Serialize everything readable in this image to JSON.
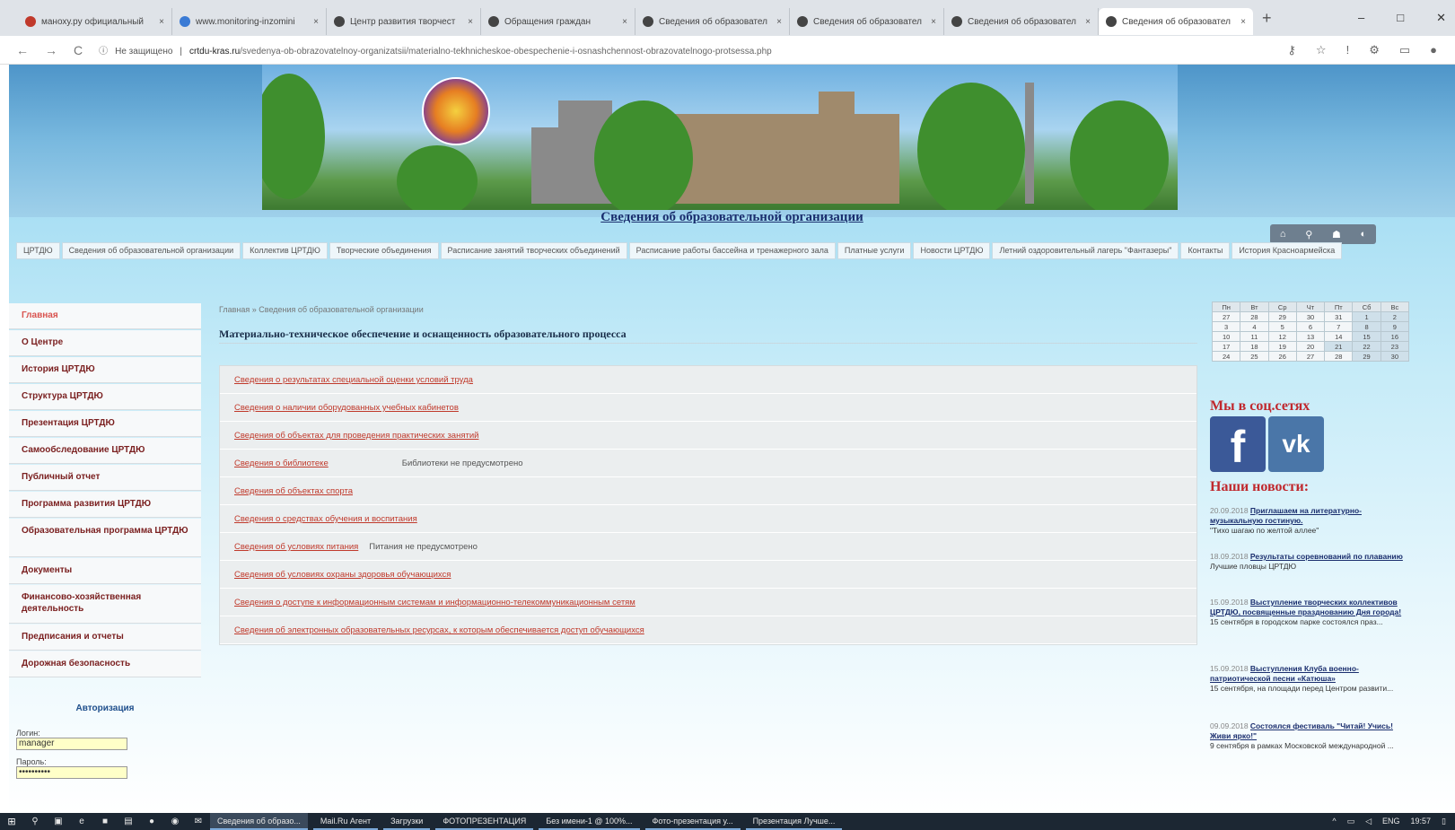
{
  "browser": {
    "tabs": [
      {
        "title": "маноху.ру официальный"
      },
      {
        "title": "www.monitoring-inzomini"
      },
      {
        "title": "Центр развития творчест"
      },
      {
        "title": "Обращения граждан"
      },
      {
        "title": "Сведения об образовател"
      },
      {
        "title": "Сведения об образовател"
      },
      {
        "title": "Сведения об образовател"
      },
      {
        "title": "Сведения об образовател"
      }
    ],
    "new_tab": "+",
    "minimize": "–",
    "maximize": "□",
    "close": "✕",
    "back": "←",
    "forward": "→",
    "reload": "C",
    "security_label": "Не защищено",
    "url_host": "crtdu-kras.ru",
    "url_path": "/svedenya-ob-obrazovatelnoy-organizatsii/materialno-tekhnicheskoe-obespechenie-i-osnashchennost-obrazovatelnogo-protsessa.php"
  },
  "site": {
    "title": "Сведения об образовательной организации",
    "top_menu": [
      "ЦРТДЮ",
      "Сведения об образовательной организации",
      "Коллектив ЦРТДЮ",
      "Творческие объединения",
      "Расписание занятий творческих объединений",
      "Расписание работы бассейна и тренажерного зала",
      "Платные услуги",
      "Новости ЦРТДЮ",
      "Летний оздоровительный лагерь \"Фантазеры\"",
      "Контакты",
      "История Красноармейска"
    ],
    "sidebar": [
      "Главная",
      "О Центре",
      "История ЦРТДЮ",
      "Структура ЦРТДЮ",
      "Презентация ЦРТДЮ",
      "Самообследование ЦРТДЮ",
      "Публичный отчет",
      "Программа развития ЦРТДЮ",
      "Образовательная программа ЦРТДЮ",
      "Документы",
      "Финансово-хозяйственная деятельность",
      "Предписания и отчеты",
      "Дорожная безопасность"
    ],
    "auth": {
      "title": "Авторизация",
      "login_label": "Логин:",
      "login_value": "manager",
      "password_label": "Пароль:",
      "password_value": "••••••••••"
    },
    "breadcrumb": "Главная » Сведения об образовательной организации",
    "heading": "Материально-техническое обеспечение и оснащенность образовательного процесса",
    "links": [
      {
        "text": "Сведения о результатах специальной оценки условий труда",
        "note": ""
      },
      {
        "text": "Сведения о наличии оборудованных учебных кабинетов",
        "note": ""
      },
      {
        "text": "Сведения об объектах для проведения практических занятий",
        "note": ""
      },
      {
        "text": "Сведения о библиотеке",
        "note": "Библиотеки не предусмотрено"
      },
      {
        "text": "Сведения об объектах спорта",
        "note": ""
      },
      {
        "text": "Сведения о средствах обучения и воспитания",
        "note": ""
      },
      {
        "text": "Сведения об условиях питания",
        "note": "Питания не предусмотрено"
      },
      {
        "text": "Сведения об условиях охраны здоровья обучающихся",
        "note": ""
      },
      {
        "text": "Сведения о доступе к информационным системам и информационно-телекоммуникационным сетям",
        "note": ""
      },
      {
        "text": "Сведения об электронных образовательных ресурсах, к которым обеспечивается доступ обучающихся",
        "note": ""
      }
    ],
    "calendar": {
      "days": [
        "Пн",
        "Вт",
        "Ср",
        "Чт",
        "Пт",
        "Сб",
        "Вс"
      ],
      "weeks": [
        [
          "27",
          "28",
          "29",
          "30",
          "31",
          "1",
          "2"
        ],
        [
          "3",
          "4",
          "5",
          "6",
          "7",
          "8",
          "9"
        ],
        [
          "10",
          "11",
          "12",
          "13",
          "14",
          "15",
          "16"
        ],
        [
          "17",
          "18",
          "19",
          "20",
          "21",
          "22",
          "23"
        ],
        [
          "24",
          "25",
          "26",
          "27",
          "28",
          "29",
          "30"
        ]
      ]
    },
    "social_heading": "Мы в соц.сетях",
    "facebook_glyph": "f",
    "vk_glyph": "vk",
    "news_heading": "Наши новости:",
    "news": [
      {
        "date": "20.09.2018",
        "title": "Приглашаем на литературно-музыкальную гостиную.",
        "text": "\"Тихо шагаю по желтой аллее\""
      },
      {
        "date": "18.09.2018",
        "title": "Результаты соревнований по плаванию",
        "text": "Лучшие пловцы ЦРТДЮ"
      },
      {
        "date": "15.09.2018",
        "title": "Выступление творческих коллективов ЦРТДЮ, посвященные празднованию Дня города!",
        "text": "15 сентября в городском парке состоялся праз..."
      },
      {
        "date": "15.09.2018",
        "title": "Выступления Клуба военно-патриотической песни «Катюша»",
        "text": "15 сентября, на площади перед Центром развити..."
      },
      {
        "date": "09.09.2018",
        "title": "Состоялся фестиваль \"Читай! Учись! Живи ярко!\"",
        "text": "9 сентября в рамках Московской международной ..."
      }
    ]
  },
  "taskbar": {
    "tasks": [
      {
        "label": "Сведения об образо...",
        "active": true
      },
      {
        "label": "Mail.Ru Агент",
        "active": false
      },
      {
        "label": "Загрузки",
        "active": false
      },
      {
        "label": "ФОТОПРЕЗЕНТАЦИЯ",
        "active": false
      },
      {
        "label": "Без имени-1 @ 100%...",
        "active": false
      },
      {
        "label": "Фото-презентация у...",
        "active": false
      },
      {
        "label": "Презентация Лучше...",
        "active": false
      }
    ],
    "lang": "ENG",
    "time": "19:57"
  },
  "colors": {
    "link": "#c0392b",
    "menu_text": "#7a1f1f",
    "heading_red": "#c0282d",
    "title_blue": "#1a2e6e"
  }
}
